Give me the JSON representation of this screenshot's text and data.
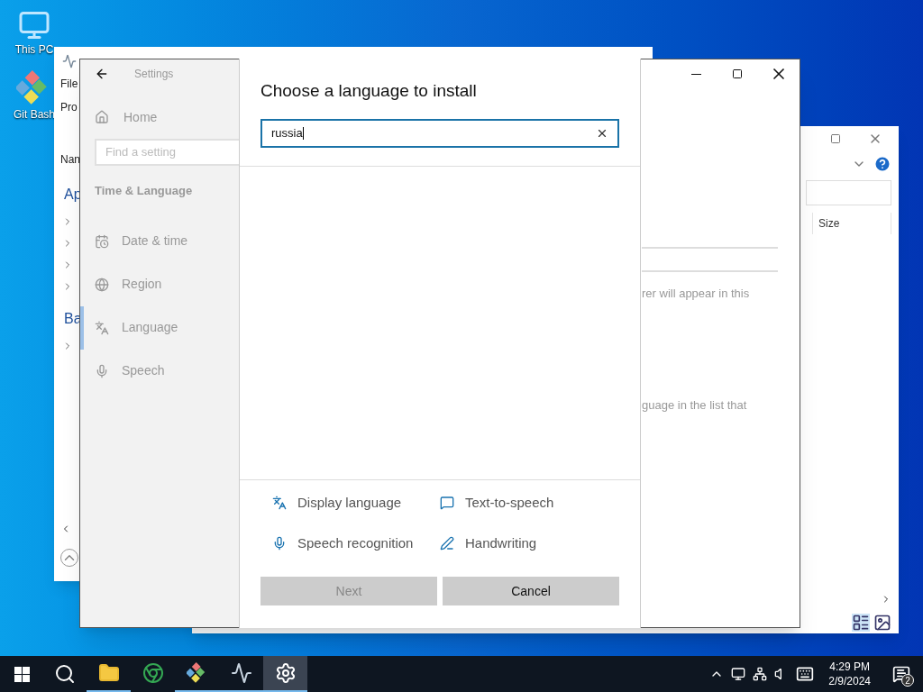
{
  "desktop_icons": [
    {
      "label": "This PC"
    },
    {
      "label": "Git Bash"
    }
  ],
  "back_window": {
    "menu": "File",
    "texts": [
      "Pro",
      "Nan"
    ],
    "sections": [
      "Ap",
      "Ba"
    ]
  },
  "explorer_window": {
    "column": "Size"
  },
  "settings": {
    "title": "Settings",
    "home": "Home",
    "search_placeholder": "Find a setting",
    "category": "Time & Language",
    "items": [
      {
        "label": "Date & time",
        "selected": false
      },
      {
        "label": "Region",
        "selected": false
      },
      {
        "label": "Language",
        "selected": true
      },
      {
        "label": "Speech",
        "selected": false
      }
    ],
    "content_texts": [
      "rer will appear in this",
      "guage in the list that"
    ]
  },
  "dialog": {
    "title": "Choose a language to install",
    "search": {
      "value": "russia"
    },
    "features": [
      {
        "label": "Display language"
      },
      {
        "label": "Text-to-speech"
      },
      {
        "label": "Speech recognition"
      },
      {
        "label": "Handwriting"
      }
    ],
    "buttons": [
      {
        "label": "Next",
        "disabled": true
      },
      {
        "label": "Cancel",
        "disabled": false
      }
    ]
  },
  "taskbar": {
    "apps": [
      {
        "running": true,
        "selected": false
      },
      {
        "running": false,
        "selected": false
      },
      {
        "running": true,
        "selected": false
      },
      {
        "running": true,
        "selected": false
      },
      {
        "running": true,
        "selected": true
      }
    ]
  },
  "clock": {
    "time": "4:29 PM",
    "date": "2/9/2024"
  },
  "notifications": {
    "count": "2"
  }
}
